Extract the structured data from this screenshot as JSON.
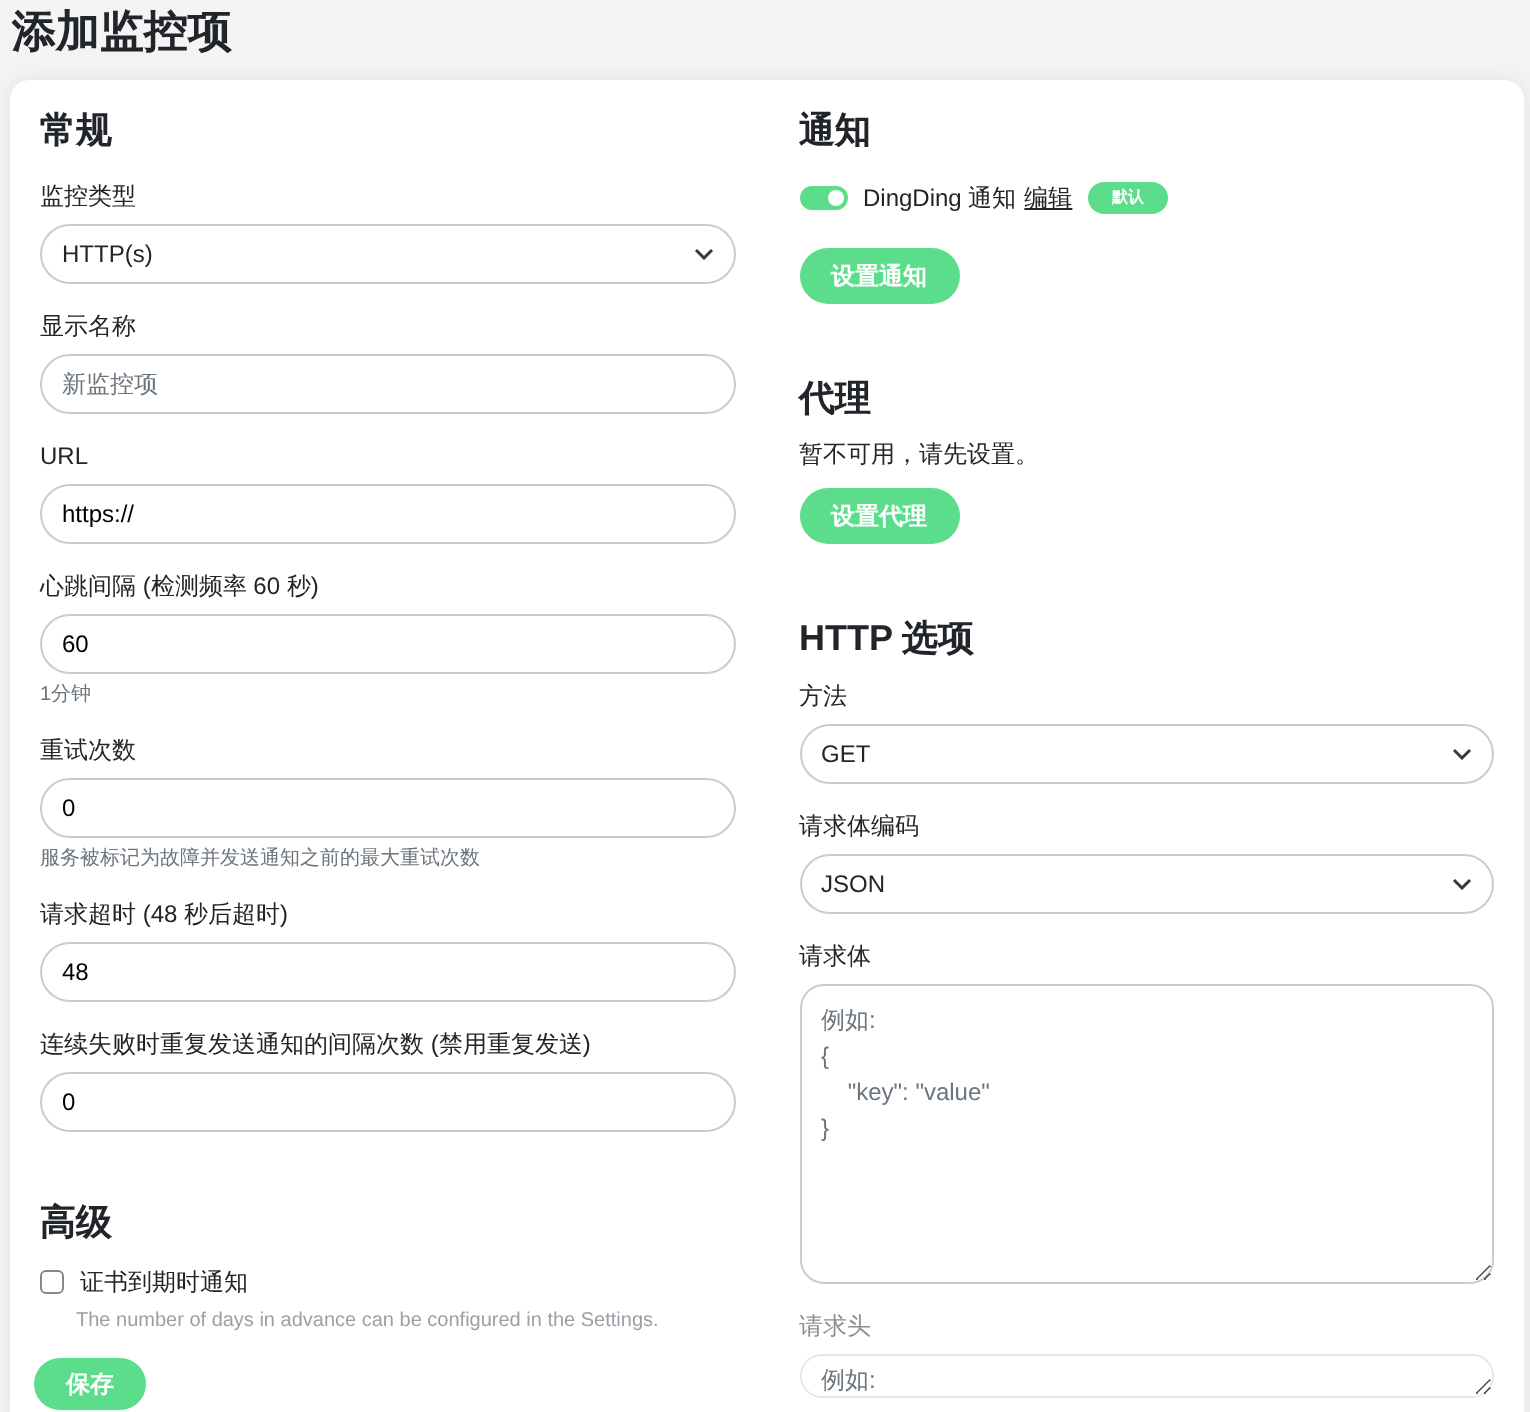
{
  "page_title": "添加监控项",
  "general": {
    "heading": "常规",
    "fields": [
      {
        "kind": "select",
        "label": "监控类型",
        "value": "HTTP(s)"
      },
      {
        "kind": "input",
        "label": "显示名称",
        "placeholder": "新监控项"
      },
      {
        "kind": "input",
        "label": "URL",
        "value": "https://"
      },
      {
        "kind": "input",
        "label": "心跳间隔 (检测频率 60 秒)",
        "value": "60",
        "help": "1分钟"
      },
      {
        "kind": "input",
        "label": "重试次数",
        "value": "0",
        "help": "服务被标记为故障并发送通知之前的最大重试次数"
      },
      {
        "kind": "input",
        "label": "请求超时 (48 秒后超时)",
        "value": "48"
      },
      {
        "kind": "input",
        "label": "连续失败时重复发送通知的间隔次数 (禁用重复发送)",
        "value": "0"
      }
    ]
  },
  "advanced": {
    "heading": "高级",
    "checkboxes": [
      {
        "label": "证书到期时通知",
        "checked": false,
        "help": "The number of days in advance can be configured in the Settings."
      }
    ]
  },
  "notifications": {
    "heading": "通知",
    "items": [
      {
        "name": "DingDing 通知",
        "on": true,
        "edit": "编辑",
        "badge": "默认"
      }
    ],
    "button": "设置通知"
  },
  "proxy": {
    "heading": "代理",
    "message": "暂不可用，请先设置。",
    "button": "设置代理"
  },
  "http_options": {
    "heading": "HTTP 选项",
    "fields": [
      {
        "kind": "select",
        "label": "方法",
        "value": "GET"
      },
      {
        "kind": "select",
        "label": "请求体编码",
        "value": "JSON"
      },
      {
        "kind": "textarea",
        "label": "请求体",
        "placeholder": "例如:\n{\n    \"key\": \"value\"\n}"
      },
      {
        "kind": "textarea",
        "label": "请求头",
        "placeholder": "例如:"
      }
    ]
  },
  "save_button": "保存"
}
